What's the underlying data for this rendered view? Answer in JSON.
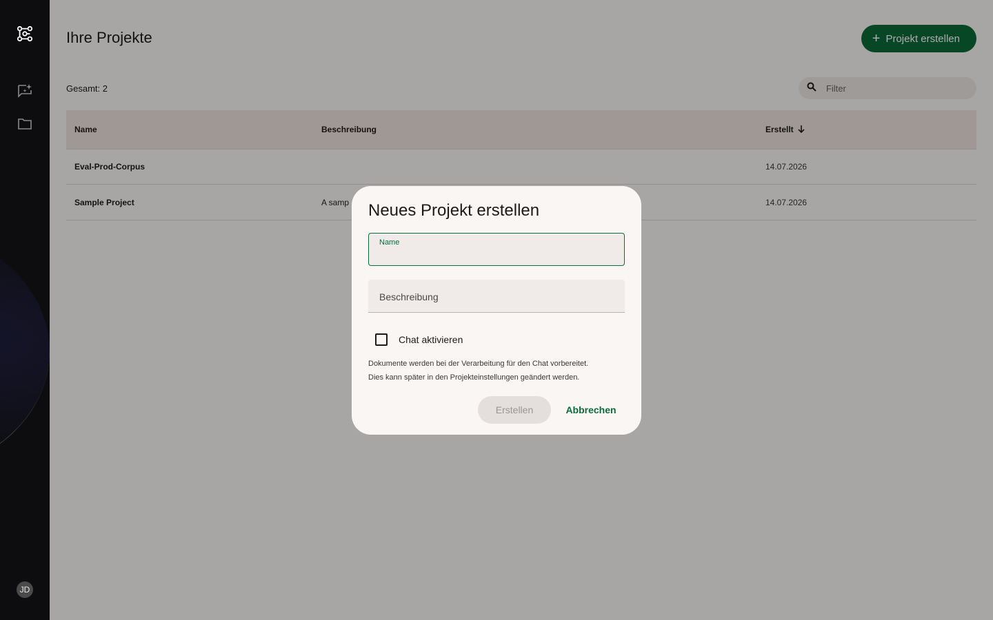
{
  "sidebar": {
    "logo_icon": "workflow-logo-icon",
    "items": [
      {
        "icon": "chat-sparkle-icon"
      },
      {
        "icon": "folder-icon"
      }
    ],
    "avatar_initials": "JD"
  },
  "header": {
    "title": "Ihre Projekte",
    "create_button_label": "Projekt erstellen"
  },
  "toolbar": {
    "total_label": "Gesamt: 2",
    "filter_placeholder": "Filter"
  },
  "table": {
    "columns": {
      "name": "Name",
      "description": "Beschreibung",
      "created": "Erstellt"
    },
    "rows": [
      {
        "name": "Eval-Prod-Corpus",
        "description": "",
        "created": "14.07.2026"
      },
      {
        "name": "Sample Project",
        "description": "A samp",
        "created": "14.07.2026"
      }
    ]
  },
  "dialog": {
    "title": "Neues Projekt erstellen",
    "name_label": "Name",
    "name_value": "",
    "description_label": "Beschreibung",
    "checkbox_label": "Chat aktivieren",
    "checkbox_checked": false,
    "hint_line1": "Dokumente werden bei der Verarbeitung für den Chat vorbereitet.",
    "hint_line2": "Dies kann später in den Projekteinstellungen geändert werden.",
    "submit_label": "Erstellen",
    "cancel_label": "Abbrechen"
  },
  "colors": {
    "accent": "#0b6b3a",
    "sidebar": "#0d0d0f",
    "surface": "#fbf8f6",
    "table_header": "#efe3df"
  }
}
